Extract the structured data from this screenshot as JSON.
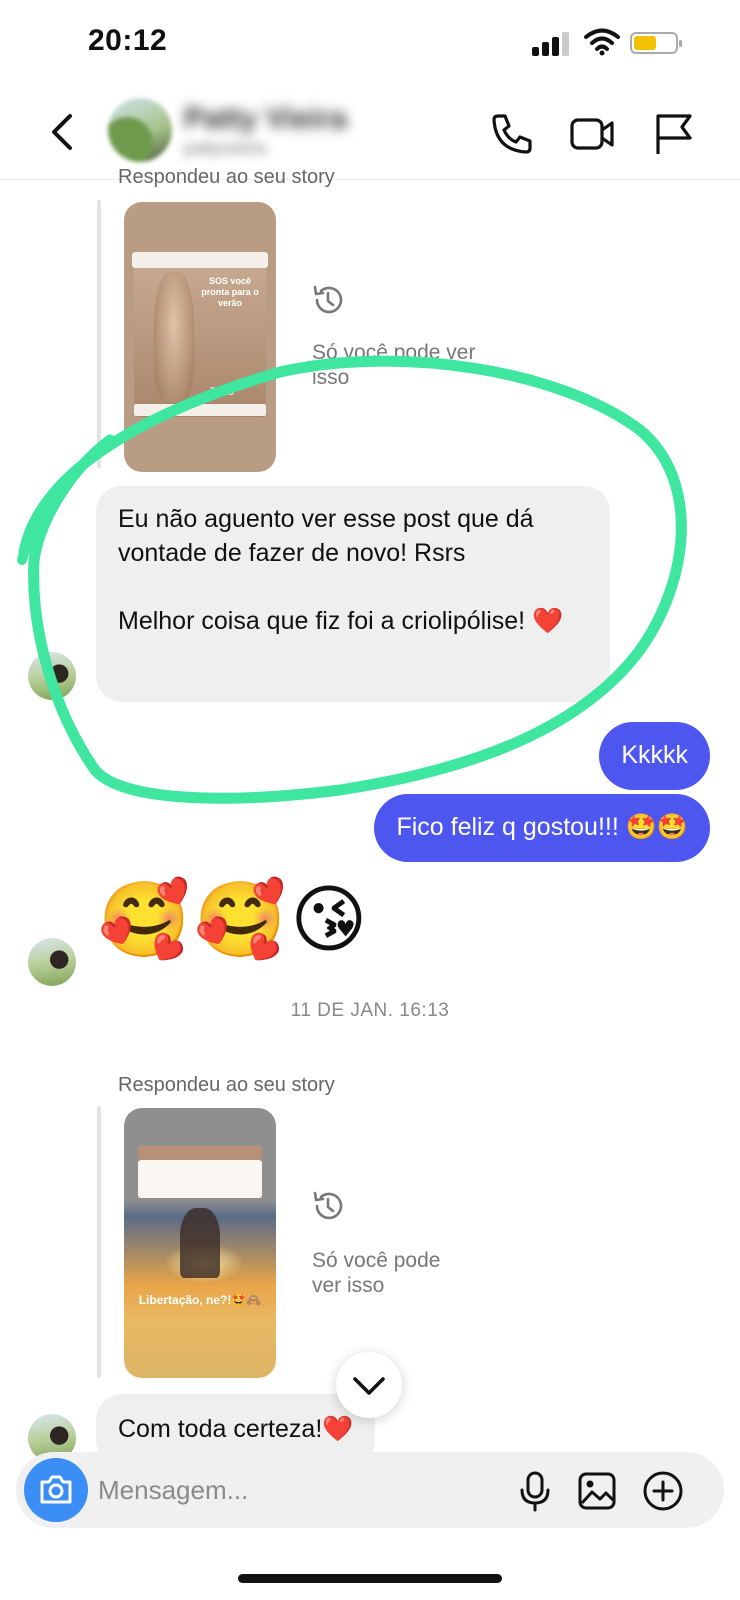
{
  "status_bar": {
    "time": "20:12",
    "battery_color": "#f2c200"
  },
  "header": {
    "contact_name": "Patty Vieira",
    "contact_username": "pattyvieira",
    "back_icon": "chevron-left-icon",
    "call_icon": "phone-icon",
    "video_icon": "video-camera-icon",
    "flag_icon": "flag-icon"
  },
  "chat": {
    "story_reply_1": {
      "caption": "Respondeu ao seu story",
      "only_you": "Só você pode ver isso",
      "story_title": "SOS você pronta para o verão",
      "story_brand": "Tuko"
    },
    "incoming_message_1": {
      "line1": "Eu não aguento ver esse post que dá vontade de fazer de novo! Rsrs",
      "line2": "Melhor coisa que fiz foi a criolipólise!",
      "emoji": "❤️"
    },
    "outgoing_1": "Kkkkk",
    "outgoing_2": "Fico feliz q gostou!!! 🤩🤩",
    "emoji_message": "🥰🥰😘",
    "date_separator": "11 DE JAN. 16:13",
    "story_reply_2": {
      "caption": "Respondeu ao seu story",
      "only_you_line1": "Só você pode",
      "only_you_line2": "ver isso",
      "story_label": "Libertação, ne?!🤩🙈"
    },
    "incoming_message_2": "Com toda certeza!",
    "incoming_message_2_emoji": "❤️"
  },
  "composer": {
    "placeholder": "Mensagem...",
    "camera_icon": "camera-icon",
    "mic_icon": "microphone-icon",
    "gallery_icon": "image-icon",
    "add_icon": "plus-circle-icon"
  },
  "colors": {
    "outgoing_bubble": "#4e56f0",
    "incoming_bubble": "#efefef",
    "annotation_stroke": "#3ee6a0",
    "camera_button": "#3a8ef6"
  }
}
